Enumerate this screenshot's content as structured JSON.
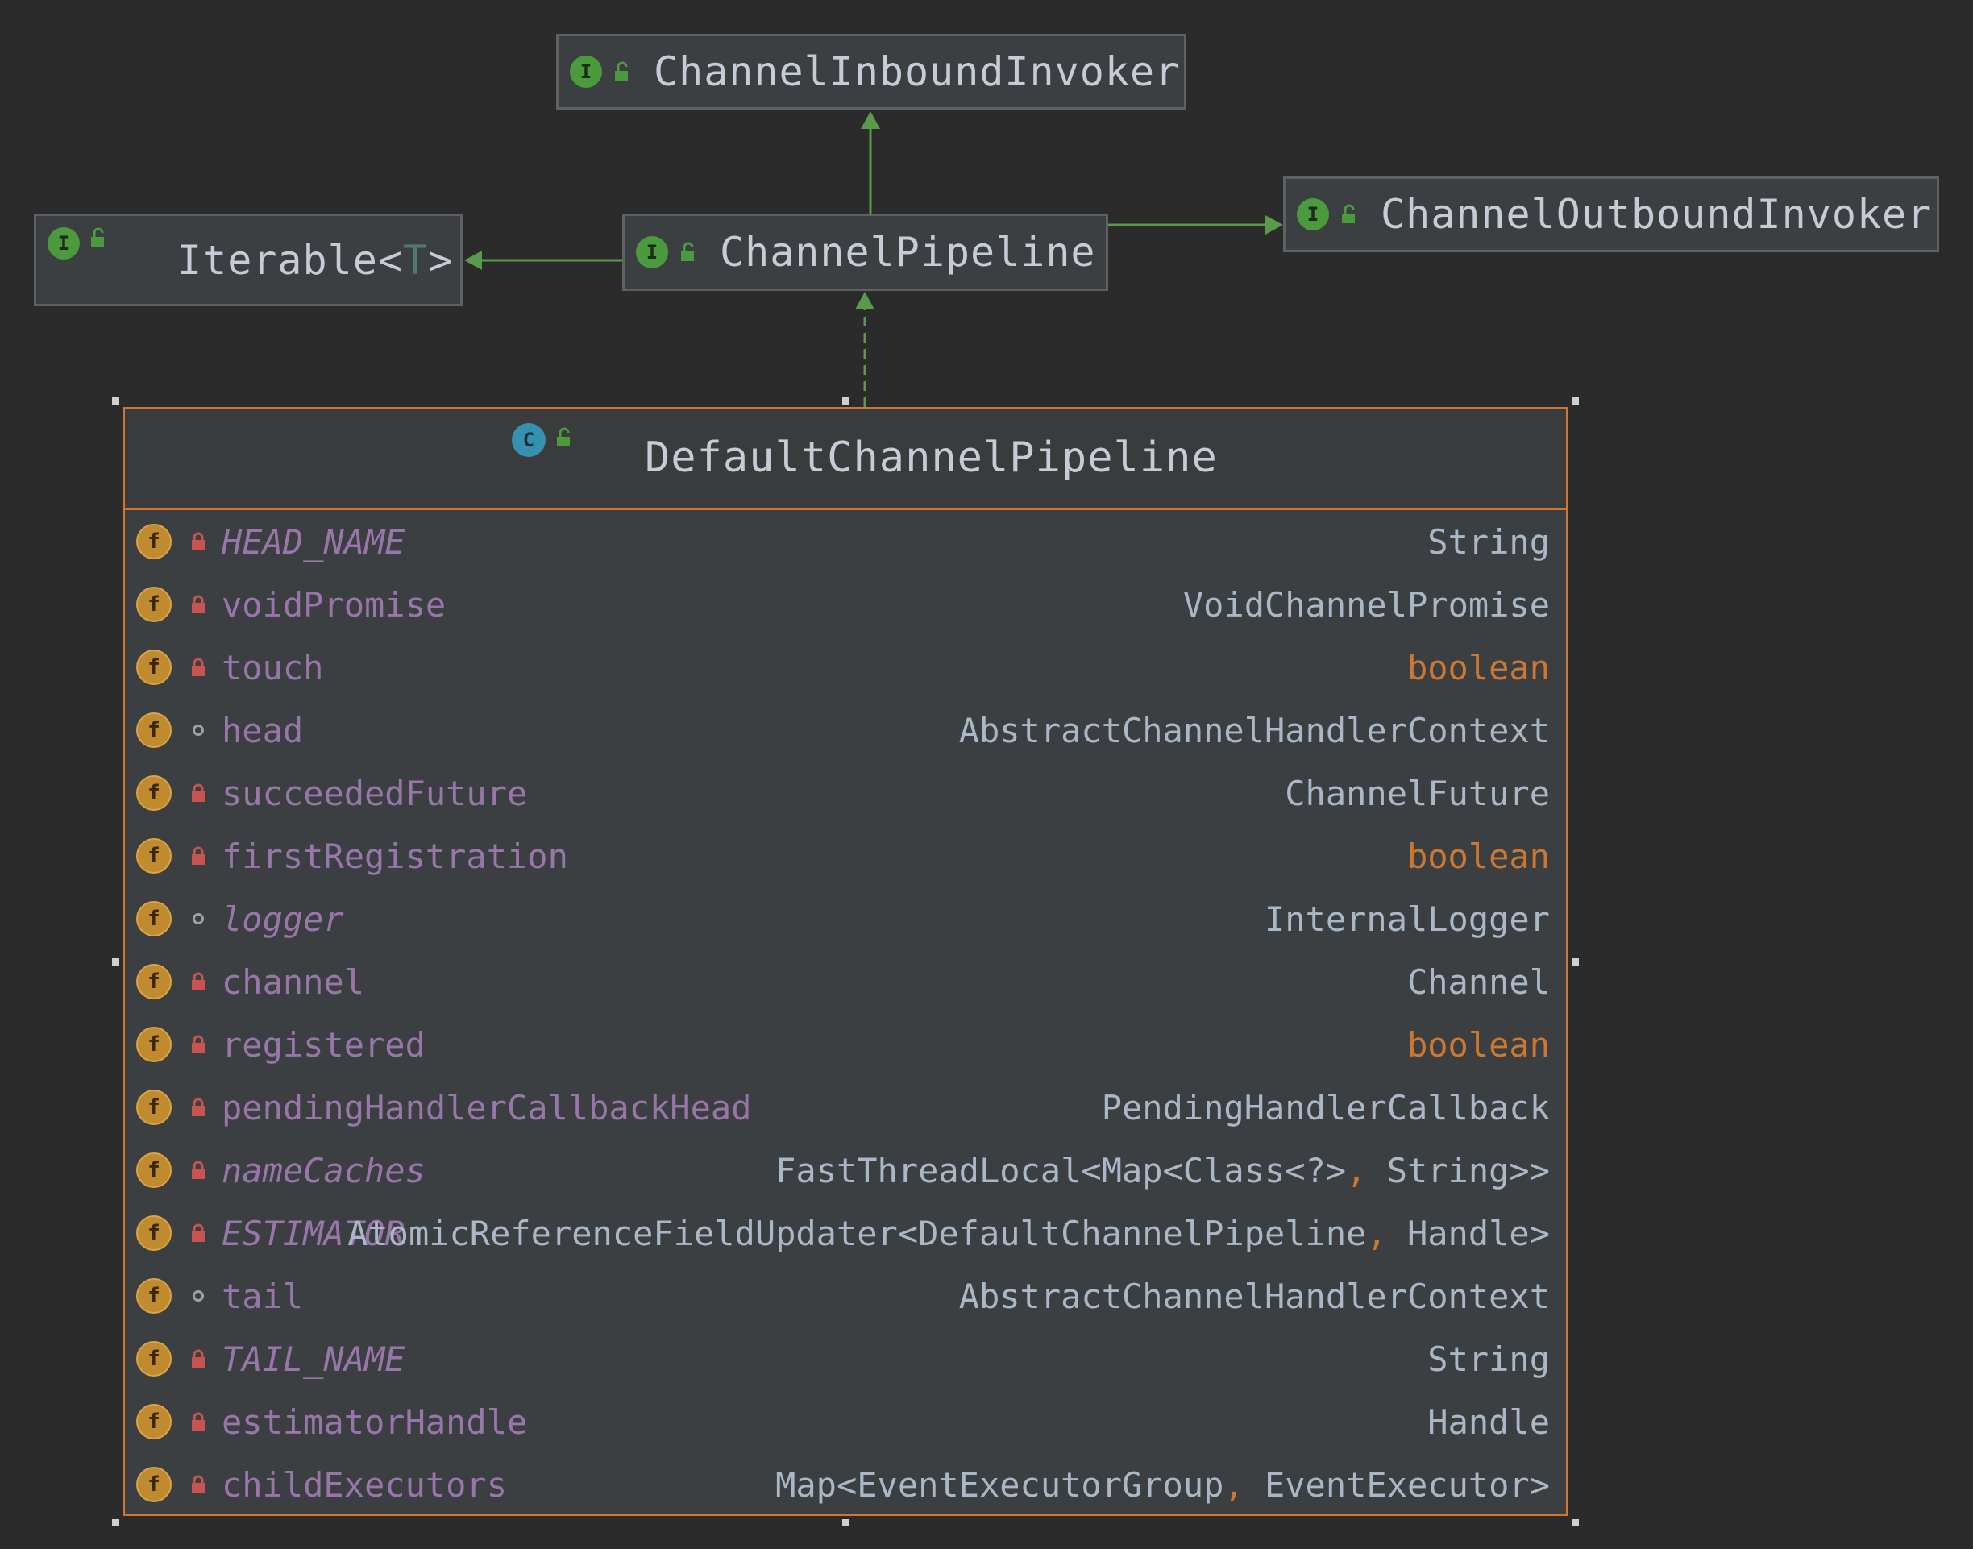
{
  "nodes": {
    "inbound": {
      "title": "ChannelInboundInvoker",
      "badge": "I"
    },
    "outbound": {
      "title": "ChannelOutboundInvoker",
      "badge": "I"
    },
    "iterable": {
      "title_main": "Iterable<",
      "title_param": "T",
      "title_end": ">",
      "badge": "I"
    },
    "pipeline": {
      "title": "ChannelPipeline",
      "badge": "I"
    },
    "default": {
      "title": "DefaultChannelPipeline",
      "badge": "C"
    }
  },
  "fields": [
    {
      "name": "HEAD_NAME",
      "type": "String",
      "static": true,
      "access": "private",
      "primitive": false
    },
    {
      "name": "voidPromise",
      "type": "VoidChannelPromise",
      "static": false,
      "access": "private",
      "primitive": false
    },
    {
      "name": "touch",
      "type": "boolean",
      "static": false,
      "access": "private",
      "primitive": true
    },
    {
      "name": "head",
      "type": "AbstractChannelHandlerContext",
      "static": false,
      "access": "package",
      "primitive": false
    },
    {
      "name": "succeededFuture",
      "type": "ChannelFuture",
      "static": false,
      "access": "private",
      "primitive": false
    },
    {
      "name": "firstRegistration",
      "type": "boolean",
      "static": false,
      "access": "private",
      "primitive": true
    },
    {
      "name": "logger",
      "type": "InternalLogger",
      "static": true,
      "access": "package",
      "primitive": false
    },
    {
      "name": "channel",
      "type": "Channel",
      "static": false,
      "access": "private",
      "primitive": false
    },
    {
      "name": "registered",
      "type": "boolean",
      "static": false,
      "access": "private",
      "primitive": true
    },
    {
      "name": "pendingHandlerCallbackHead",
      "type": "PendingHandlerCallback",
      "static": false,
      "access": "private",
      "primitive": false
    },
    {
      "name": "nameCaches",
      "type": "FastThreadLocal<Map<Class<?>, String>>",
      "static": true,
      "access": "private",
      "primitive": false
    },
    {
      "name": "ESTIMATOR",
      "type": "AtomicReferenceFieldUpdater<DefaultChannelPipeline, Handle>",
      "static": true,
      "access": "private",
      "primitive": false
    },
    {
      "name": "tail",
      "type": "AbstractChannelHandlerContext",
      "static": false,
      "access": "package",
      "primitive": false
    },
    {
      "name": "TAIL_NAME",
      "type": "String",
      "static": true,
      "access": "private",
      "primitive": false
    },
    {
      "name": "estimatorHandle",
      "type": "Handle",
      "static": false,
      "access": "private",
      "primitive": false
    },
    {
      "name": "childExecutors",
      "type": "Map<EventExecutorGroup, EventExecutor>",
      "static": false,
      "access": "private",
      "primitive": false
    }
  ],
  "colors": {
    "background": "#2b2b2b",
    "node_fill": "#3c3f41",
    "selected_border": "#cc7832",
    "edge": "#5a9a4a",
    "field_name": "#9876aa",
    "keyword": "#cc7832",
    "text": "#a9b7c6"
  },
  "icons": {
    "interface": "interface-badge-icon",
    "class": "class-badge-icon",
    "field": "field-badge-icon",
    "private": "lock-icon",
    "package": "package-dot-icon",
    "public": "unlock-icon"
  }
}
